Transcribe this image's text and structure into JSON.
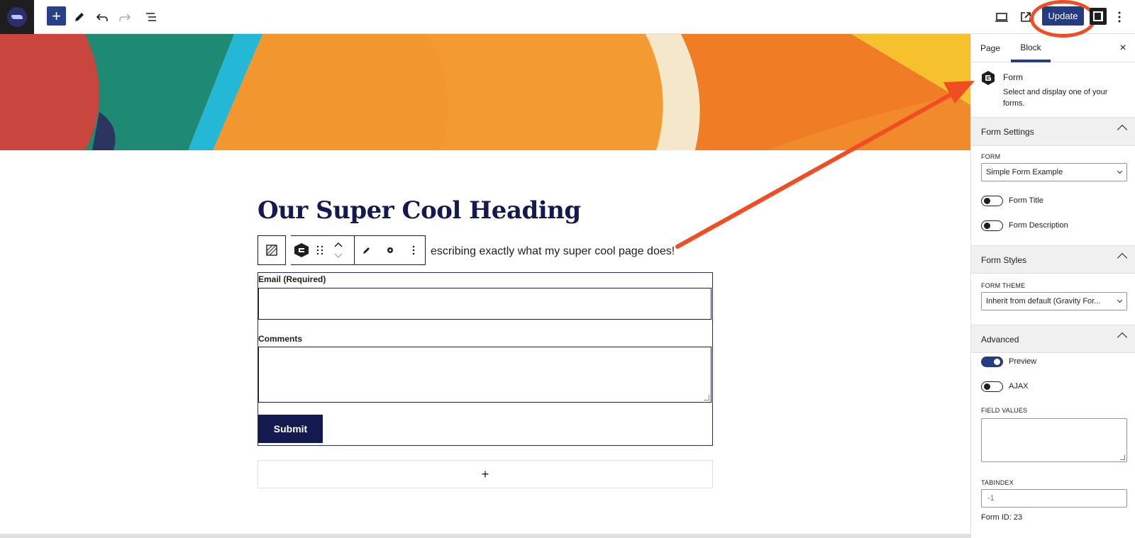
{
  "toolbar": {
    "add_label": "+",
    "update_label": "Update"
  },
  "content": {
    "heading": "Our Super Cool Heading",
    "paragraph": "This is a paragraph describing exactly what my super cool page does!",
    "paragraph_visible": "escribing exactly what my super cool page does!",
    "form": {
      "email_label": "Email (Required)",
      "comments_label": "Comments",
      "submit_label": "Submit"
    },
    "appender_label": "+"
  },
  "sidebar": {
    "tabs": [
      {
        "label": "Page",
        "active": false
      },
      {
        "label": "Block",
        "active": true
      }
    ],
    "close_label": "×",
    "block_card": {
      "title": "Form",
      "description": "Select and display one of your forms."
    },
    "form_settings": {
      "title": "Form Settings",
      "form_caption": "FORM",
      "form_value": "Simple Form Example",
      "form_title_label": "Form Title",
      "form_description_label": "Form Description"
    },
    "form_styles": {
      "title": "Form Styles",
      "theme_caption": "FORM THEME",
      "theme_value": "Inherit from default (Gravity For..."
    },
    "advanced": {
      "title": "Advanced",
      "preview_label": "Preview",
      "ajax_label": "AJAX",
      "field_values_caption": "FIELD VALUES",
      "tabindex_caption": "TABINDEX",
      "tabindex_placeholder": "-1",
      "form_id_text": "Form ID: 23"
    }
  },
  "colors": {
    "accent": "#253c83",
    "annotation": "#f04d23",
    "heading": "#141a4f"
  }
}
